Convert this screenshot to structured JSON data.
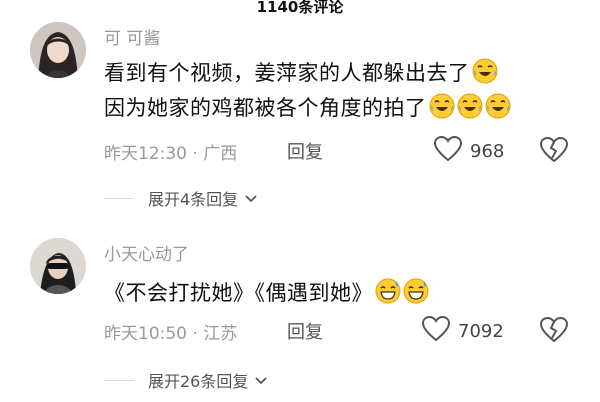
{
  "header": {
    "title": "1140条评论"
  },
  "comments": [
    {
      "username": "可 可酱",
      "lines": [
        "看到有个视频，姜萍家的人都躲出去了",
        "因为她家的鸡都被各个角度的拍了"
      ],
      "time": "昨天12:30",
      "location": "广西",
      "reply_label": "回复",
      "likes": "968",
      "expand_label": "展开4条回复"
    },
    {
      "username": "小天心动了",
      "lines": [
        "《不会打扰她》《偶遇到她》"
      ],
      "time": "昨天10:50",
      "location": "江苏",
      "reply_label": "回复",
      "likes": "7092",
      "expand_label": "展开26条回复"
    }
  ],
  "meta_separator": " · ",
  "icons": {
    "emoji_laugh_cry": "laugh-cry-emoji-icon",
    "emoji_grin_sweat": "grin-sweat-emoji-icon",
    "like": "heart-icon",
    "dislike": "broken-heart-icon",
    "expand": "chevron-down-icon"
  }
}
